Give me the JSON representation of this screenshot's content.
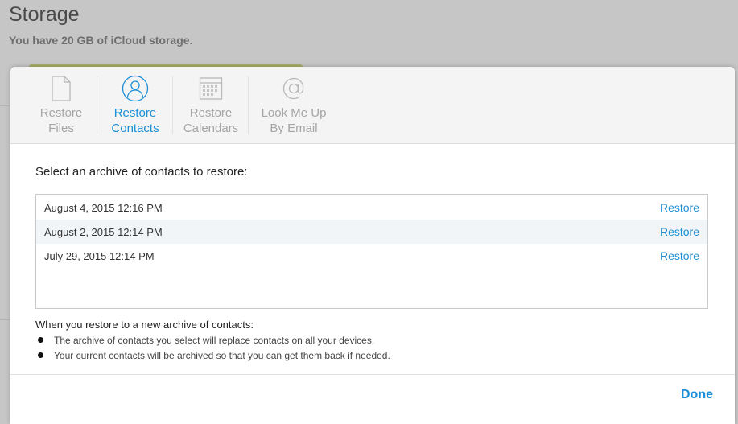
{
  "background": {
    "title": "Storage",
    "subtitle": "You have 20 GB of iCloud storage."
  },
  "tabs": [
    {
      "label": "Restore\nFiles",
      "icon": "file-icon",
      "active": false
    },
    {
      "label": "Restore\nContacts",
      "icon": "contacts-icon",
      "active": true
    },
    {
      "label": "Restore\nCalendars",
      "icon": "calendar-icon",
      "active": false
    },
    {
      "label": "Look Me Up\nBy Email",
      "icon": "at-sign-icon",
      "active": false
    }
  ],
  "prompt": "Select an archive of contacts to restore:",
  "archives": [
    {
      "date": "August 4, 2015 12:16 PM",
      "action": "Restore"
    },
    {
      "date": "August 2, 2015 12:14 PM",
      "action": "Restore"
    },
    {
      "date": "July 29, 2015 12:14 PM",
      "action": "Restore"
    }
  ],
  "note": {
    "title": "When you restore to a new archive of contacts:",
    "bullets": [
      "The archive of contacts you select will replace contacts on all your devices.",
      "Your current contacts will be archived so that you can get them back if needed."
    ]
  },
  "footer": {
    "done_label": "Done"
  },
  "colors": {
    "accent": "#1b8fd6",
    "inactive_tab": "#a5a5a5"
  }
}
